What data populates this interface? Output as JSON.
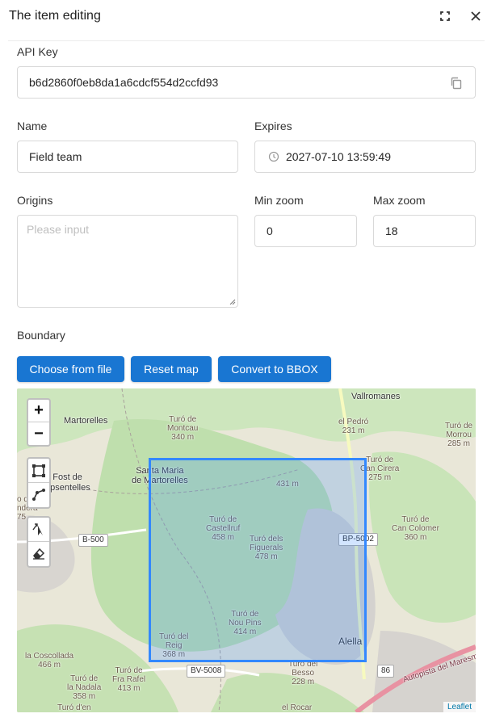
{
  "dialog": {
    "title": "The item editing"
  },
  "form": {
    "api_key": {
      "label": "API Key",
      "value": "b6d2860f0eb8da1a6cdcf554d2ccfd93"
    },
    "name": {
      "label": "Name",
      "value": "Field team"
    },
    "expires": {
      "label": "Expires",
      "value": "2027-07-10 13:59:49"
    },
    "origins": {
      "label": "Origins",
      "placeholder": "Please input"
    },
    "min_zoom": {
      "label": "Min zoom",
      "value": "0"
    },
    "max_zoom": {
      "label": "Max zoom",
      "value": "18"
    },
    "boundary": {
      "label": "Boundary"
    }
  },
  "buttons": {
    "choose_file": "Choose from file",
    "reset_map": "Reset map",
    "convert_bbox": "Convert to BBOX"
  },
  "map": {
    "zoom_in": "+",
    "zoom_out": "−",
    "attribution": "Leaflet",
    "places": [
      {
        "name": "Vallromanes"
      },
      {
        "name": "Martorelles"
      },
      {
        "name": "Santa Maria\nde Martorelles"
      },
      {
        "name": "nt Fost de\nmpsentelles"
      },
      {
        "name": "Alella"
      }
    ],
    "peaks": [
      {
        "name": "Turó de\nMontcau\n340 m"
      },
      {
        "name": "el Pedró\n231 m"
      },
      {
        "name": "Turó de\nMorrou\n285 m"
      },
      {
        "name": "Turó de\nCan Cirera\n275 m"
      },
      {
        "name": "431 m"
      },
      {
        "name": "Turó de\nCastellruf\n458 m"
      },
      {
        "name": "Turó dels\nFiguerals\n478 m"
      },
      {
        "name": "Turó de\nCan Colomer\n360 m"
      },
      {
        "name": "Turó de\nNou Pins\n414 m"
      },
      {
        "name": "Turó del\nReig\n368 m"
      },
      {
        "name": "la Coscollada\n466 m"
      },
      {
        "name": "Turó de\nFra Rafel\n413 m"
      },
      {
        "name": "Turó de\nla Nadala\n358 m"
      },
      {
        "name": "Turó del\nBesso\n228 m"
      },
      {
        "name": "el Rocar"
      },
      {
        "name": "Turó d'en"
      },
      {
        "name": "o de\nndera\n75"
      }
    ],
    "roads": [
      {
        "name": "B-500"
      },
      {
        "name": "BP-5002"
      },
      {
        "name": "BV-5008"
      },
      {
        "name": "86"
      }
    ],
    "highway_label": "Autopista del Maresme"
  },
  "colors": {
    "primary": "#1976d2",
    "bbox": "#3388ff"
  }
}
